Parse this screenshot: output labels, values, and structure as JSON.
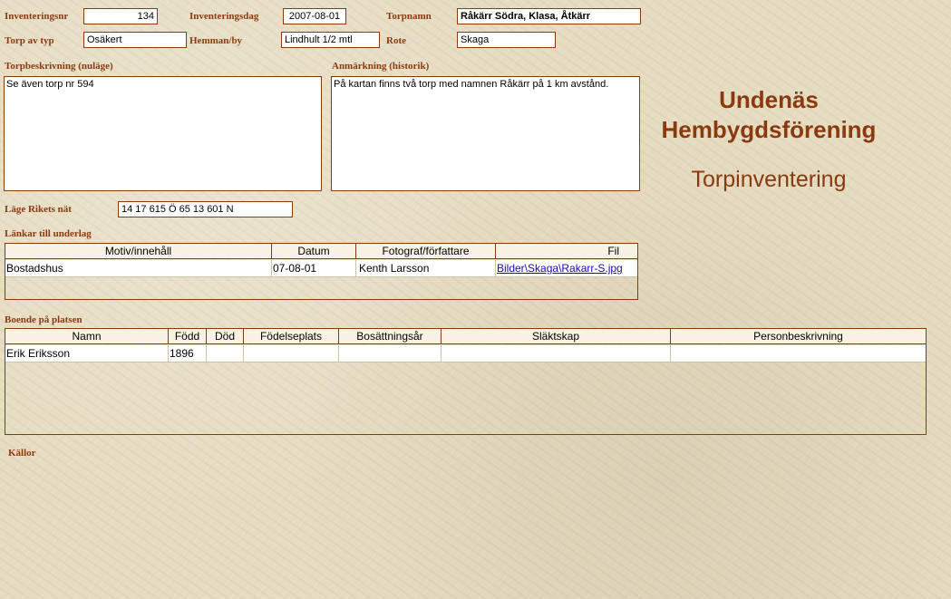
{
  "header": {
    "inventeringsnr_label": "Inventeringsnr",
    "inventeringsnr_value": "134",
    "inventeringsdag_label": "Inventeringsdag",
    "inventeringsdag_value": "2007-08-01",
    "torpnamn_label": "Torpnamn",
    "torpnamn_value": "Råkärr Södra,  Klasa, Åtkärr",
    "torp_typ_label": "Torp av typ",
    "torp_typ_value": "Osäkert",
    "hemman_label": "Hemman/by",
    "hemman_value": "Lindhult 1/2 mtl",
    "rote_label": "Rote",
    "rote_value": "Skaga"
  },
  "descriptions": {
    "torpbeskrivning_label": "Torpbeskrivning (nuläge)",
    "torpbeskrivning_value": "Se även torp nr 594",
    "anmarkning_label": "Anmärkning (historik)",
    "anmarkning_value": "På kartan finns två torp med namnen Råkärr på 1 km avstånd."
  },
  "branding": {
    "title_line1": "Undenäs",
    "title_line2": "Hembygdsförening",
    "subtitle": "Torpinventering"
  },
  "position": {
    "label": "Läge Rikets nät",
    "value": "14 17 615 Ö  65 13 601 N"
  },
  "links": {
    "label": "Länkar till underlag",
    "columns": [
      "Motiv/innehåll",
      "Datum",
      "Fotograf/författare",
      "Fil"
    ],
    "rows": [
      {
        "motiv": "Bostadshus",
        "datum": "07-08-01",
        "fotograf": "Kenth Larsson",
        "fil": "Bilder\\Skaga\\Rakarr-S.jpg"
      }
    ]
  },
  "residents": {
    "label": "Boende på platsen",
    "columns": [
      "Namn",
      "Född",
      "Död",
      "Födelseplats",
      "Bosättningsår",
      "Släktskap",
      "Personbeskrivning"
    ],
    "rows": [
      {
        "namn": "Erik Eriksson",
        "fodd": "1896",
        "dod": "",
        "fodelseplats": "",
        "bosattningsar": "",
        "slaktskap": "",
        "personbeskrivning": ""
      }
    ]
  },
  "sources": {
    "label": "Källor"
  },
  "colors": {
    "accent": "#8b3a0e",
    "background": "#e6dcc2",
    "link": "#1a0dab"
  }
}
